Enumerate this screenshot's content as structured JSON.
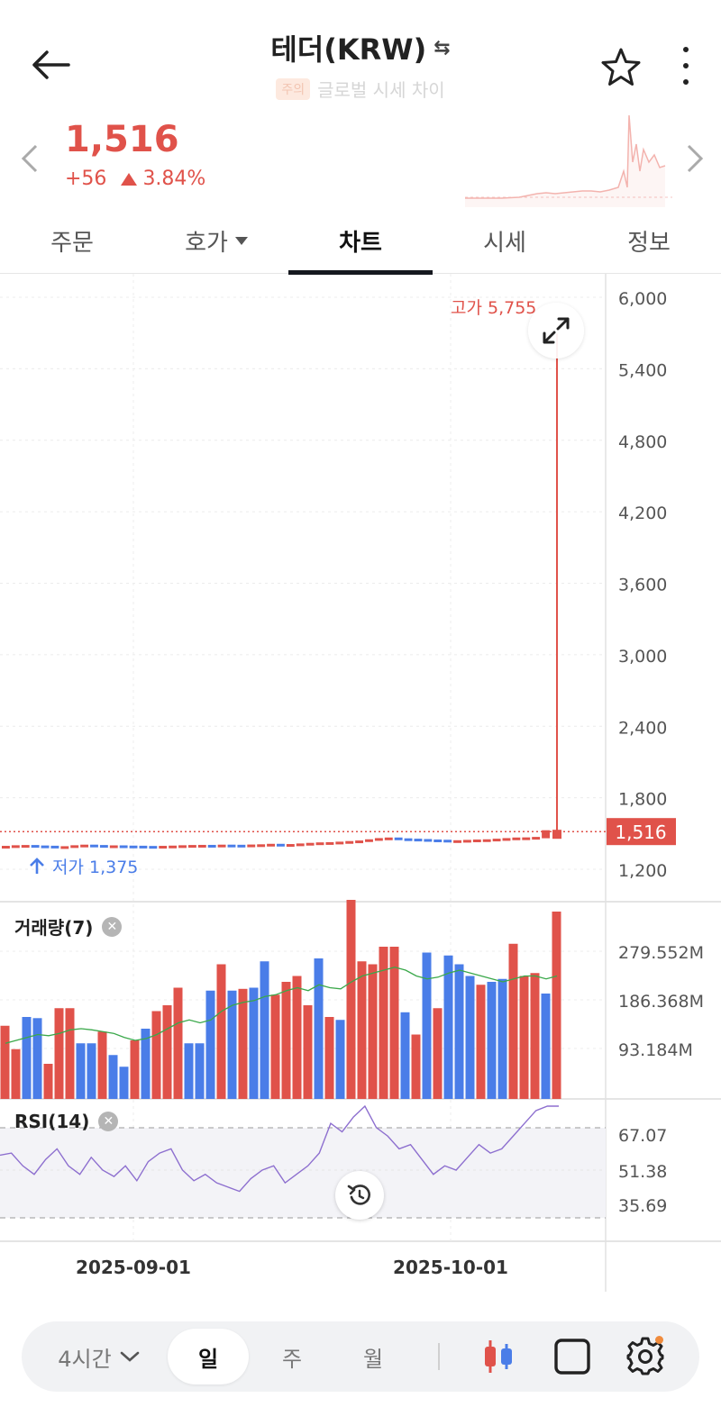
{
  "header": {
    "title": "테더(KRW)",
    "badge": "주의",
    "subtitle": "글로벌 시세 차이"
  },
  "price": {
    "current": "1,516",
    "change": "+56",
    "change_percent": "3.84%",
    "color_up": "#e0524a"
  },
  "tabs": [
    {
      "label": "주문"
    },
    {
      "label": "호가"
    },
    {
      "label": "차트"
    },
    {
      "label": "시세"
    },
    {
      "label": "정보"
    }
  ],
  "chart_labels": {
    "high": "고가 5,755",
    "low": "저가 1,375",
    "current_tag": "1,516",
    "volume_title": "거래량(7)",
    "rsi_title": "RSI(14)"
  },
  "chart_data": [
    {
      "type": "candlestick",
      "y_ticks": [
        "6,000",
        "5,400",
        "4,800",
        "4,200",
        "3,600",
        "3,000",
        "2,400",
        "1,800",
        "1,200"
      ],
      "ylim": [
        1200,
        6000
      ],
      "x_ticks": [
        "2025-09-01",
        "2025-10-01"
      ],
      "close_series": [
        1385,
        1390,
        1392,
        1388,
        1386,
        1380,
        1382,
        1390,
        1395,
        1392,
        1388,
        1389,
        1387,
        1386,
        1384,
        1382,
        1385,
        1387,
        1390,
        1392,
        1393,
        1392,
        1395,
        1394,
        1392,
        1396,
        1398,
        1402,
        1395,
        1400,
        1405,
        1410,
        1414,
        1416,
        1420,
        1425,
        1430,
        1440,
        1450,
        1455,
        1448,
        1445,
        1442,
        1438,
        1436,
        1430,
        1432,
        1435,
        1438,
        1440,
        1445,
        1450,
        1455,
        1456,
        1460,
        1516
      ],
      "high": 5755,
      "low": 1375,
      "current": 1516
    },
    {
      "type": "bar",
      "title": "거래량(7)",
      "y_ticks": [
        "279.552M",
        "186.368M",
        "93.184M"
      ],
      "ylim": [
        0,
        320
      ],
      "values": [
        125,
        85,
        140,
        138,
        60,
        155,
        155,
        95,
        95,
        115,
        75,
        55,
        100,
        120,
        150,
        160,
        190,
        95,
        95,
        185,
        230,
        185,
        188,
        190,
        235,
        178,
        200,
        210,
        160,
        240,
        140,
        135,
        340,
        235,
        230,
        260,
        260,
        148,
        110,
        250,
        155,
        245,
        230,
        210,
        195,
        200,
        205,
        265,
        210,
        215,
        180,
        320
      ],
      "colors": [
        "up",
        "up",
        "down",
        "down",
        "up",
        "up",
        "up",
        "down",
        "down",
        "up",
        "down",
        "down",
        "up",
        "down",
        "up",
        "up",
        "up",
        "down",
        "down",
        "down",
        "up",
        "down",
        "up",
        "down",
        "down",
        "up",
        "up",
        "up",
        "up",
        "down",
        "up",
        "down",
        "up",
        "up",
        "up",
        "up",
        "up",
        "down",
        "up",
        "down",
        "up",
        "down",
        "down",
        "down",
        "up",
        "down",
        "down",
        "up",
        "up",
        "up",
        "down",
        "up"
      ],
      "ma_values": [
        95,
        100,
        105,
        110,
        108,
        112,
        118,
        120,
        118,
        115,
        112,
        105,
        100,
        103,
        110,
        120,
        130,
        135,
        130,
        135,
        150,
        160,
        165,
        168,
        175,
        178,
        185,
        190,
        185,
        195,
        190,
        188,
        200,
        210,
        215,
        220,
        225,
        220,
        210,
        205,
        208,
        215,
        220,
        215,
        210,
        205,
        200,
        205,
        210,
        210,
        205,
        210
      ]
    },
    {
      "type": "line",
      "title": "RSI(14)",
      "y_ticks": [
        "67.07",
        "51.38",
        "35.69"
      ],
      "ylim": [
        25,
        75
      ],
      "values": [
        57,
        58,
        52,
        48,
        55,
        60,
        52,
        48,
        56,
        50,
        47,
        52,
        45,
        54,
        58,
        60,
        50,
        45,
        48,
        44,
        42,
        40,
        46,
        50,
        52,
        44,
        48,
        52,
        58,
        72,
        68,
        75,
        85,
        70,
        66,
        60,
        62,
        55,
        48,
        52,
        50,
        56,
        62,
        58,
        60,
        66,
        72,
        78,
        85,
        95
      ]
    }
  ],
  "toolbar": {
    "interval": "4시간",
    "day": "일",
    "week": "주",
    "month": "월"
  }
}
